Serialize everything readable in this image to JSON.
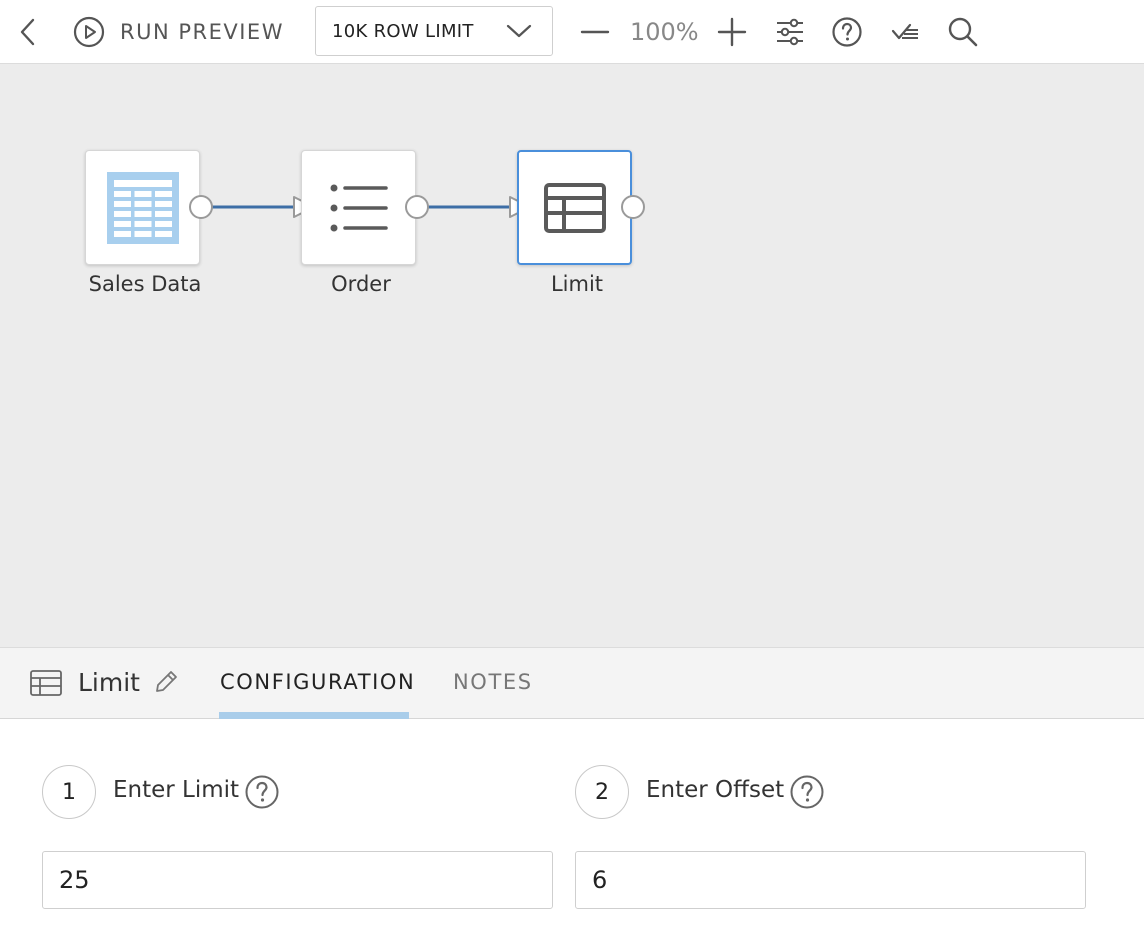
{
  "toolbar": {
    "back_icon": "chevron-left-icon",
    "run_icon": "play-circle-icon",
    "run_label": "RUN PREVIEW",
    "row_limit": {
      "selected": "10K ROW LIMIT"
    },
    "zoom_level": "100%",
    "icons": [
      "minus-icon",
      "plus-icon",
      "sliders-icon",
      "help-icon",
      "checklist-icon",
      "search-icon"
    ]
  },
  "canvas": {
    "nodes": [
      {
        "label": "Sales Data",
        "icon": "table-data-icon",
        "selected": false
      },
      {
        "label": "Order",
        "icon": "list-icon",
        "selected": false
      },
      {
        "label": "Limit",
        "icon": "table-limit-icon",
        "selected": true
      }
    ],
    "connector_color": "#3d6ea6",
    "selected_border_color": "#4a8fdb"
  },
  "panel": {
    "title": "Limit",
    "tabs": [
      {
        "label": "CONFIGURATION",
        "active": true
      },
      {
        "label": "NOTES",
        "active": false
      }
    ],
    "active_tab_color": "#a9cdea"
  },
  "config": {
    "fields": [
      {
        "step": "1",
        "label": "Enter Limit",
        "value": "25"
      },
      {
        "step": "2",
        "label": "Enter Offset",
        "value": "6"
      }
    ]
  }
}
